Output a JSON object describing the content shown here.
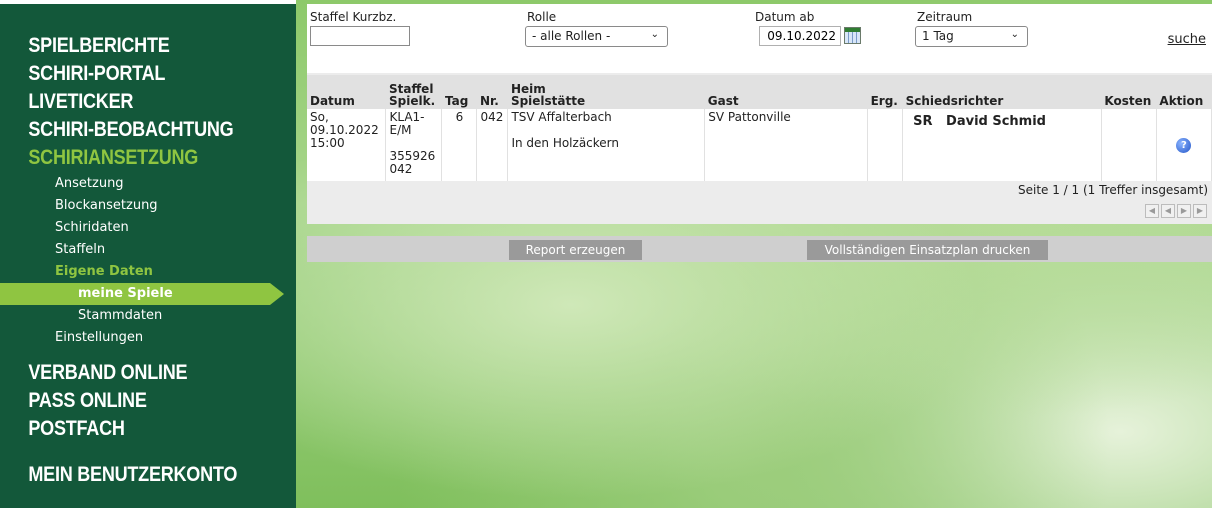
{
  "sidebar": {
    "main_items": [
      {
        "label": "SPIELBERICHTE"
      },
      {
        "label": "SCHIRI-PORTAL"
      },
      {
        "label": "LIVETICKER"
      },
      {
        "label": "SCHIRI-BEOBACHTUNG"
      },
      {
        "label": "SCHIRIANSETZUNG"
      }
    ],
    "sub_items": [
      {
        "label": "Ansetzung"
      },
      {
        "label": "Blockansetzung"
      },
      {
        "label": "Schiridaten"
      },
      {
        "label": "Staffeln"
      },
      {
        "label": "Eigene Daten"
      },
      {
        "label": "meine Spiele"
      },
      {
        "label": "Stammdaten"
      },
      {
        "label": "Einstellungen"
      }
    ],
    "bottom_items": [
      {
        "label": "VERBAND ONLINE"
      },
      {
        "label": "PASS ONLINE"
      },
      {
        "label": "POSTFACH"
      },
      {
        "label": "MEIN BENUTZERKONTO"
      }
    ]
  },
  "search": {
    "staffel_label": "Staffel Kurzbz.",
    "staffel_value": "",
    "rolle_label": "Rolle",
    "rolle_value": "- alle Rollen -",
    "datum_label": "Datum ab",
    "datum_value": "09.10.2022",
    "zeitraum_label": "Zeitraum",
    "zeitraum_value": "1 Tag",
    "search_link": "suche"
  },
  "table": {
    "headers": {
      "datum": "Datum",
      "staffel_line1": "Staffel",
      "staffel_line2": "Spielk.",
      "tag": "Tag",
      "nr": "Nr.",
      "heim_line1": "Heim",
      "heim_line2": "Spielstätte",
      "gast": "Gast",
      "erg": "Erg.",
      "schiri": "Schiedsrichter",
      "kosten": "Kosten",
      "aktion": "Aktion"
    },
    "rows": [
      {
        "datum_line1": "So,",
        "datum_line2": "09.10.2022",
        "datum_line3": "15:00",
        "staffel_line1": "KLA1-",
        "staffel_line2": "E/M",
        "spielk_line1": "355926",
        "spielk_line2": "042",
        "tag": "6",
        "nr": "042",
        "heim": "TSV Affalterbach",
        "spielstaette": "In den Holzäckern",
        "gast": "SV Pattonville",
        "erg": "",
        "schiri_role": "SR",
        "schiri_name": "David Schmid",
        "kosten": "",
        "aktion_icon": "help-icon"
      }
    ],
    "pager_text": "Seite 1 / 1 (1 Treffer insgesamt)"
  },
  "buttons": {
    "report": "Report erzeugen",
    "print": "Vollständigen Einsatzplan drucken"
  },
  "colors": {
    "sidebar_bg": "#13583a",
    "accent": "#8fc541"
  }
}
